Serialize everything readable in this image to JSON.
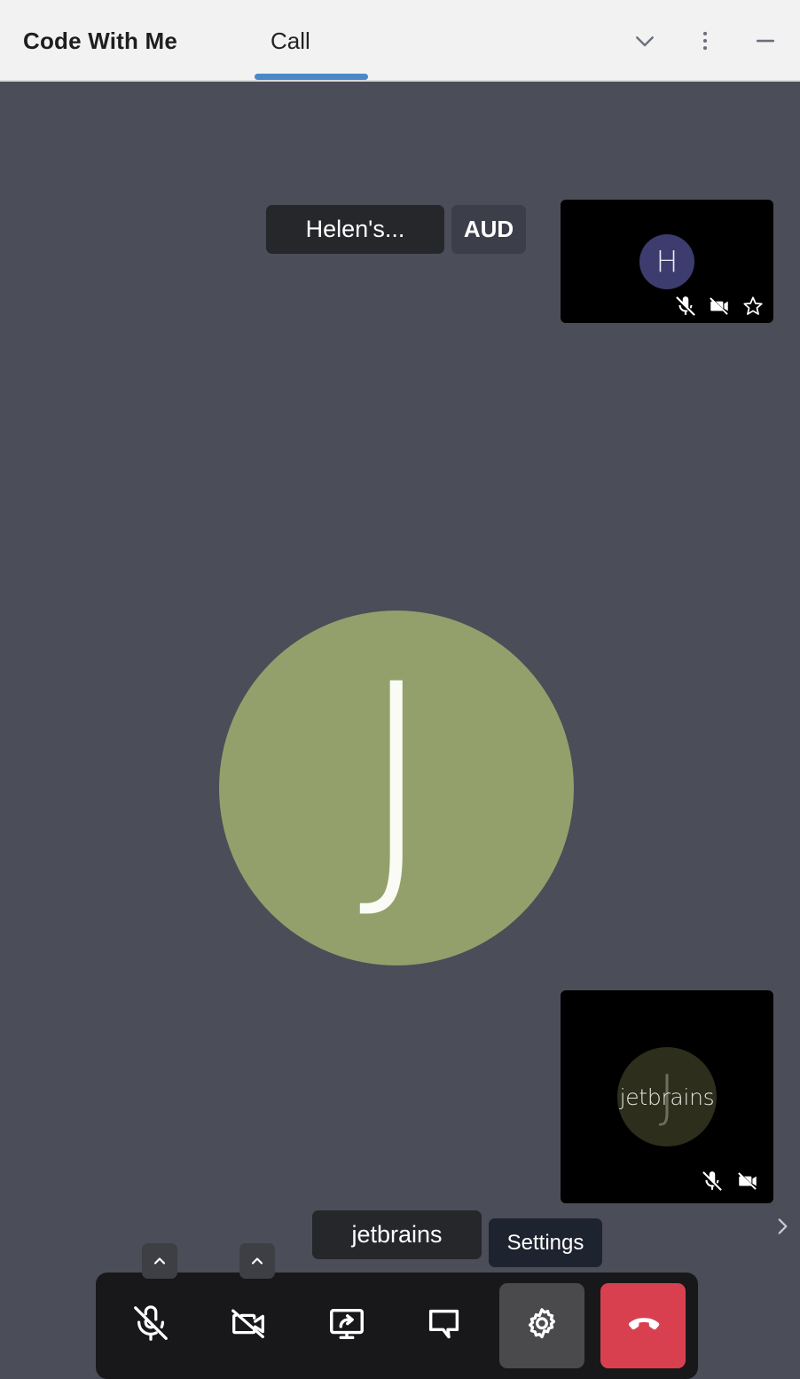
{
  "window": {
    "title": "Code With Me",
    "tabs": [
      {
        "label": "Call",
        "active": true
      }
    ],
    "controls": {
      "collapse_label": "chevron-down",
      "more_label": "more-options",
      "minimize_label": "minimize"
    }
  },
  "call": {
    "main_speaker": {
      "initial": "J",
      "avatar_color": "#93a06b"
    },
    "participants": [
      {
        "name_tooltip": "Helen's...",
        "badge": "AUD",
        "initial": "H",
        "avatar_color": "#3d3c6e",
        "mic_muted": true,
        "camera_off": true,
        "starred": false,
        "icons": [
          "mic-off-icon",
          "camera-off-icon",
          "star-icon"
        ]
      },
      {
        "name_tooltip": "jetbrains",
        "avatar_text": "jetbrains",
        "initial": "J",
        "avatar_color": "#2d2e1b",
        "mic_muted": true,
        "camera_off": true,
        "icons": [
          "mic-off-icon",
          "camera-off-icon"
        ]
      }
    ],
    "next_page_label": "chevron-right"
  },
  "toolbar": {
    "settings_tooltip": "Settings",
    "buttons": [
      {
        "name": "microphone-toggle",
        "icon": "mic-off-icon",
        "state": "muted",
        "has_chevron": true
      },
      {
        "name": "camera-toggle",
        "icon": "camera-off-icon",
        "state": "off",
        "has_chevron": true
      },
      {
        "name": "screen-share",
        "icon": "screen-share-icon",
        "state": "default",
        "has_chevron": false
      },
      {
        "name": "chat",
        "icon": "chat-icon",
        "state": "default",
        "has_chevron": false
      },
      {
        "name": "settings",
        "icon": "gear-icon",
        "state": "hovered",
        "has_chevron": false
      },
      {
        "name": "hang-up",
        "icon": "hang-up-icon",
        "state": "danger",
        "has_chevron": false
      }
    ]
  },
  "colors": {
    "stage_bg": "#4b4d59",
    "header_bg": "#f2f2f2",
    "accent_blue": "#4a88c7",
    "danger_red": "#d9404f",
    "toolbar_bg": "#18181b",
    "tooltip_bg": "#26272b",
    "badge_bg": "#3c3f4a"
  }
}
